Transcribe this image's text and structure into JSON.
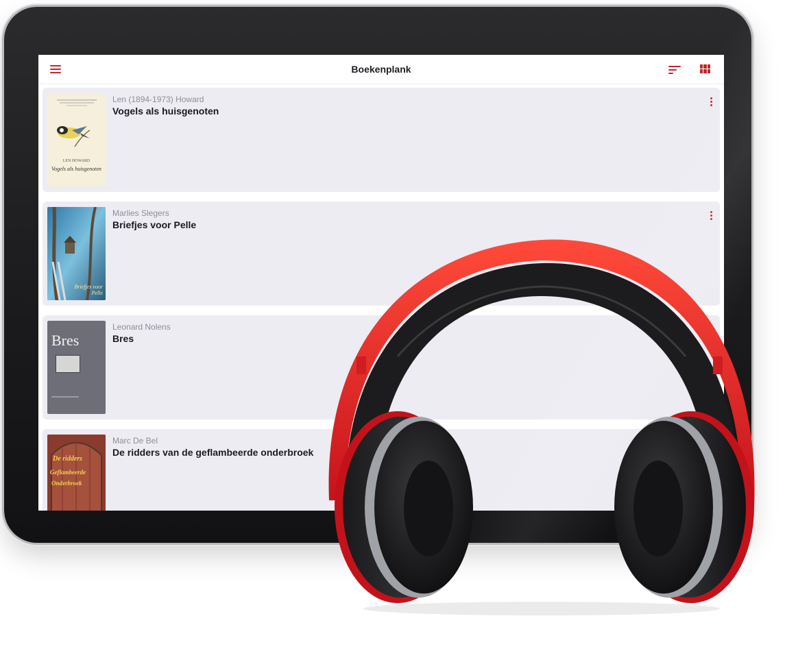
{
  "app": {
    "title": "Boekenplank",
    "accent_color": "#c2272d",
    "icons": {
      "menu": "hamburger-menu-icon",
      "sort": "sort-icon",
      "view": "grid-view-icon",
      "more": "more-vertical-icon"
    }
  },
  "books": [
    {
      "author": "Len (1894-1973) Howard",
      "title": "Vogels als huisgenoten",
      "cover_text": [
        "LEN HOWARD",
        "Vogels als huisgenoten"
      ]
    },
    {
      "author": "Marlies Slegers",
      "title": "Briefjes voor Pelle",
      "cover_text": [
        "Briefjes voor Pelle"
      ]
    },
    {
      "author": "Leonard Nolens",
      "title": "Bres",
      "cover_text": [
        "Bres"
      ]
    },
    {
      "author": "Marc De Bel",
      "title": "De ridders van de geflambeerde onderbroek",
      "cover_text": [
        "De ridders",
        "Geflambeerde",
        "Onderbroek"
      ]
    }
  ]
}
